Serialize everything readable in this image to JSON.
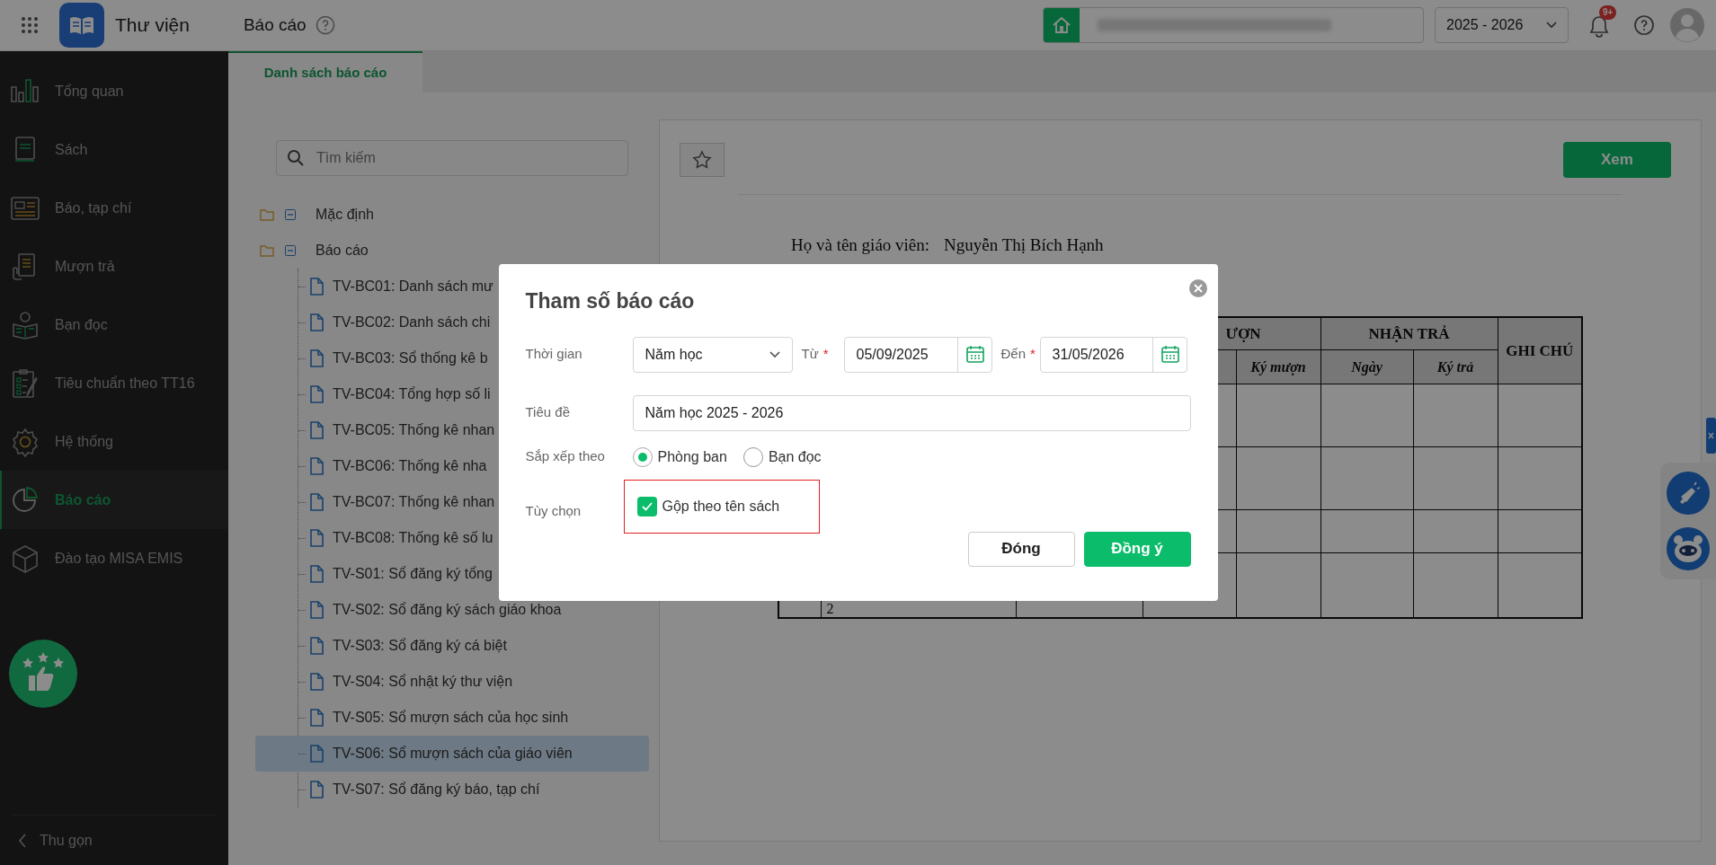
{
  "app": {
    "title": "Thư viện",
    "page_title": "Báo cáo",
    "school_year": "2025 - 2026",
    "notification_badge": "9+"
  },
  "sidebar": {
    "items": [
      {
        "label": "Tổng quan",
        "selected": false
      },
      {
        "label": "Sách",
        "selected": false
      },
      {
        "label": "Báo, tạp chí",
        "selected": false
      },
      {
        "label": "Mượn trả",
        "selected": false
      },
      {
        "label": "Bạn đọc",
        "selected": false
      },
      {
        "label": "Tiêu chuẩn theo TT16",
        "selected": false
      },
      {
        "label": "Hệ thống",
        "selected": false
      },
      {
        "label": "Báo cáo",
        "selected": true
      },
      {
        "label": "Đào tạo MISA EMIS",
        "selected": false
      }
    ],
    "collapse_label": "Thu gọn"
  },
  "tabs": [
    {
      "label": "Danh sách báo cáo",
      "selected": true
    }
  ],
  "report_list": {
    "search": {
      "placeholder": "Tìm kiếm"
    },
    "tree": [
      {
        "label": "Mặc định",
        "expanded": true
      },
      {
        "label": "Báo cáo",
        "expanded": true,
        "children": [
          {
            "label": "TV-BC01: Danh sách mư",
            "selected": false
          },
          {
            "label": "TV-BC02: Danh sách chi",
            "selected": false
          },
          {
            "label": "TV-BC03: Sổ thống kê b",
            "selected": false
          },
          {
            "label": "TV-BC04: Tổng hợp số li",
            "selected": false
          },
          {
            "label": "TV-BC05: Thống kê nhan",
            "selected": false
          },
          {
            "label": "TV-BC06: Thống kê nha",
            "selected": false
          },
          {
            "label": "TV-BC07: Thống kê nhan",
            "selected": false
          },
          {
            "label": "TV-BC08: Thống kê số lu",
            "selected": false
          },
          {
            "label": "TV-S01: Sổ đăng ký tổng",
            "selected": false
          },
          {
            "label": "TV-S02: Sổ đăng ký sách giáo khoa",
            "selected": false
          },
          {
            "label": "TV-S03: Sổ đăng ký cá biệt",
            "selected": false
          },
          {
            "label": "TV-S04: Sổ nhật ký thư viện",
            "selected": false
          },
          {
            "label": "TV-S05: Sổ mượn sách của học sinh",
            "selected": false
          },
          {
            "label": "TV-S06: Sổ mượn sách của giáo viên",
            "selected": true
          },
          {
            "label": "TV-S07: Sổ đăng ký báo, tạp chí",
            "selected": false
          }
        ]
      }
    ]
  },
  "preview": {
    "view_button": "Xem",
    "teacher_label": "Họ và tên giáo viên:",
    "teacher_name": "Nguyễn Thị Bích Hạnh",
    "table": {
      "group_headers": [
        "ƯỢN",
        "NHẬN TRẢ",
        "GHI CHÚ"
      ],
      "sub_headers": [
        "Ký mượn",
        "Ngày",
        "Ký trả"
      ],
      "last_row_cell": "2"
    }
  },
  "dialog": {
    "title": "Tham số báo cáo",
    "time": {
      "label": "Thời gian",
      "period": "Năm học",
      "from_label": "Từ",
      "from_required": "*",
      "from": "05/09/2025",
      "to_label": "Đến",
      "to_required": "*",
      "to": "31/05/2026"
    },
    "title_field": {
      "label": "Tiêu đề",
      "value": "Năm học 2025 - 2026"
    },
    "sort": {
      "label": "Sắp xếp theo",
      "options": [
        {
          "label": "Phòng ban",
          "selected": true
        },
        {
          "label": "Bạn đọc",
          "selected": false
        }
      ]
    },
    "options": {
      "label": "Tùy chọn",
      "items": [
        {
          "label": "Gộp theo tên sách",
          "checked": true,
          "highlighted": true
        }
      ]
    },
    "buttons": [
      {
        "label": "Đóng",
        "kind": "secondary"
      },
      {
        "label": "Đồng ý",
        "kind": "primary"
      }
    ]
  }
}
